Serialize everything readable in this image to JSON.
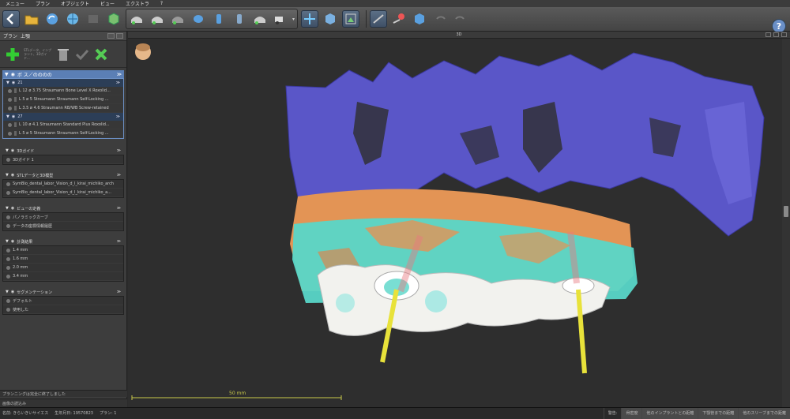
{
  "menu": [
    "メニュー",
    "プラン",
    "オブジェクト",
    "ビュー",
    "エクストラ",
    "?"
  ],
  "panel": {
    "title": "プラン",
    "title_sub": "上顎",
    "tools_text": "STLデータ、インプラント、3Dガイド...",
    "implants_section": "ボ ス／のののの"
  },
  "implant_groups": [
    {
      "label": "21",
      "items": [
        "L 12  ø 3.75   Straumann Bone Level X Roxolid...",
        "L 5  ø 5   Straumann Straumann Self-Locking ...",
        "L 3.5  ø 4.6   Straumann RB/WB Screw-retained"
      ]
    },
    {
      "label": "27",
      "items": [
        "L 10  ø 4.1   Straumann Standard Plus Roxolid...",
        "L 5  ø 5   Straumann Straumann Self-Locking ..."
      ]
    }
  ],
  "sections": [
    {
      "title": "3Dガイド",
      "items": [
        "3Dガイド 1"
      ]
    },
    {
      "title": "STLデータと3D模型",
      "items": [
        "SymBio_dental_labor_Vision_d_l_kirai_michiko_arch",
        "SymBio_dental_labor_Vision_d_l_kirai_michiko_a..."
      ]
    },
    {
      "title": "ビューの定義",
      "items": [
        "パノラミックカーブ",
        "データの座標情報履歴"
      ]
    },
    {
      "title": "計測結果",
      "items": [
        "1.4 mm",
        "1.6 mm",
        "2.0 mm",
        "3.4 mm"
      ]
    },
    {
      "title": "セグメンテーション",
      "items": [
        "デフォルト",
        "使用した"
      ]
    }
  ],
  "footer": {
    "line1": "プランニングは完全に終了しました",
    "line2": "画像の読込み"
  },
  "viewport": {
    "title": "3D",
    "scale_label": "50 mm"
  },
  "status": {
    "name": "名前: きらいきいサイエス",
    "birth": "生年月日: 19570823",
    "plan": "プラン: 1",
    "right": [
      "警告:",
      "骨密度",
      "他のインプラントとの距離",
      "下顎管までの距離",
      "他のスリーブまでの距離"
    ]
  },
  "colors": {
    "bone": "#5a56c8",
    "gum": "#e39455",
    "model_cyan": "#58d6c8",
    "guide_white": "#f2f2ee",
    "pin_yellow": "#e8e23a",
    "accent": "#5b7fb5"
  }
}
